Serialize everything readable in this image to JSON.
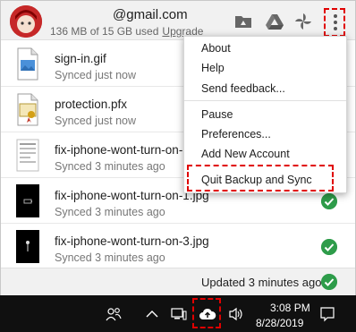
{
  "header": {
    "email": "@gmail.com",
    "storage_text": "136 MB of 15 GB used",
    "upgrade_label": "Upgrade",
    "icons": [
      "drive-folder-icon",
      "google-drive-icon",
      "google-photos-icon",
      "more-vert-icon"
    ]
  },
  "files": [
    {
      "name": "sign-in.gif",
      "status": "Synced just now",
      "thumb": "image-file-icon",
      "check": false
    },
    {
      "name": "protection.pfx",
      "status": "Synced just now",
      "thumb": "certificate-file-icon",
      "check": false
    },
    {
      "name": "fix-iphone-wont-turn-on-",
      "status": "Synced 3 minutes ago",
      "thumb": "phone-screenshot-thumb",
      "check": false
    },
    {
      "name": "fix-iphone-wont-turn-on-1.jpg",
      "status": "Synced 3 minutes ago",
      "thumb": "phone-screenshot-thumb",
      "check": true
    },
    {
      "name": "fix-iphone-wont-turn-on-3.jpg",
      "status": "Synced 3 minutes ago",
      "thumb": "phone-screenshot-thumb",
      "check": true
    }
  ],
  "footer": {
    "updated_text": "Updated 3 minutes ago"
  },
  "menu": {
    "items": [
      "About",
      "Help",
      "Send feedback...",
      "Pause",
      "Preferences...",
      "Add New Account",
      "Quit Backup and Sync"
    ]
  },
  "taskbar": {
    "time": "3:08 PM",
    "date": "8/28/2019",
    "icons": [
      "people-icon",
      "chevron-up-icon",
      "network-icon",
      "backup-sync-cloud-icon",
      "volume-icon",
      "notification-icon"
    ]
  },
  "colors": {
    "highlight_dash": "#e00000",
    "synced_check": "#2e9c4a",
    "taskbar": "#101010"
  }
}
